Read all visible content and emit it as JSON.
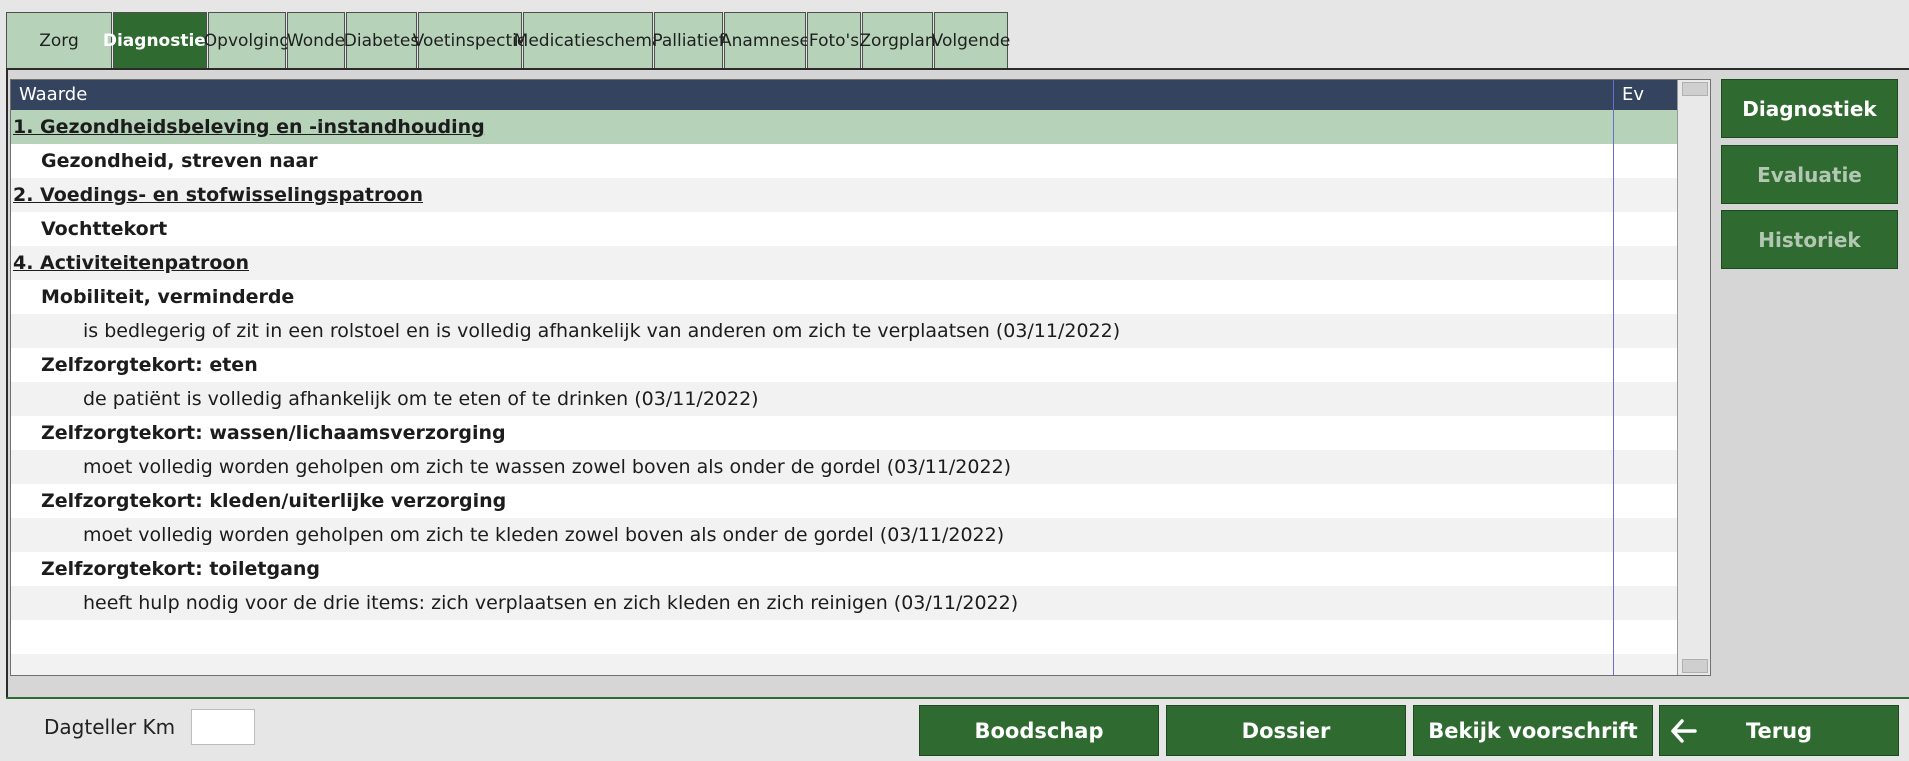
{
  "tabs": [
    "Zorg",
    "Diagnostiek",
    "Opvolging",
    "Wonde",
    "Diabetes",
    "Voetinspectie",
    "Medicatieschema",
    "Palliatief",
    "Anamnese",
    "Foto's",
    "Zorgplan",
    "Volgende"
  ],
  "active_tab": "Diagnostiek",
  "grid": {
    "col_waarde": "Waarde",
    "col_ev": "Ev",
    "rows": [
      {
        "level": 0,
        "text": "1. Gezondheidsbeleving en -instandhouding",
        "selected": true
      },
      {
        "level": 1,
        "text": "Gezondheid, streven naar"
      },
      {
        "level": 0,
        "text": "2. Voedings- en stofwisselingspatroon"
      },
      {
        "level": 1,
        "text": "Vochttekort"
      },
      {
        "level": 0,
        "text": "4. Activiteitenpatroon"
      },
      {
        "level": 1,
        "text": "Mobiliteit, verminderde"
      },
      {
        "level": 2,
        "text": "is bedlegerig of zit in een rolstoel en is volledig afhankelijk van anderen om zich te verplaatsen (03/11/2022)"
      },
      {
        "level": 1,
        "text": "Zelfzorgtekort: eten"
      },
      {
        "level": 2,
        "text": "de patiënt is volledig afhankelijk om te eten of te drinken (03/11/2022)"
      },
      {
        "level": 1,
        "text": "Zelfzorgtekort: wassen/lichaamsverzorging"
      },
      {
        "level": 2,
        "text": "moet volledig worden geholpen om zich te wassen zowel boven als onder de gordel (03/11/2022)"
      },
      {
        "level": 1,
        "text": "Zelfzorgtekort: kleden/uiterlijke verzorging"
      },
      {
        "level": 2,
        "text": "moet volledig worden geholpen om zich te kleden zowel boven als onder de gordel (03/11/2022)"
      },
      {
        "level": 1,
        "text": "Zelfzorgtekort: toiletgang"
      },
      {
        "level": 2,
        "text": "heeft hulp nodig voor de drie items: zich verplaatsen en zich kleden en zich reinigen (03/11/2022)"
      },
      {
        "level": -1,
        "text": ""
      },
      {
        "level": -1,
        "text": ""
      }
    ]
  },
  "side_buttons": {
    "diagnostiek": "Diagnostiek",
    "evaluatie": "Evaluatie",
    "historiek": "Historiek"
  },
  "footer": {
    "dagteller_label": "Dagteller Km",
    "dagteller_value": "",
    "boodschap": "Boodschap",
    "dossier": "Dossier",
    "bekijk_voorschrift": "Bekijk voorschrift",
    "terug": "Terug",
    "terug_icon": "arrow-left-icon"
  },
  "colors": {
    "accent_green": "#2f6b31",
    "tab_green": "#b6d3b9",
    "header_navy": "#34445f"
  }
}
